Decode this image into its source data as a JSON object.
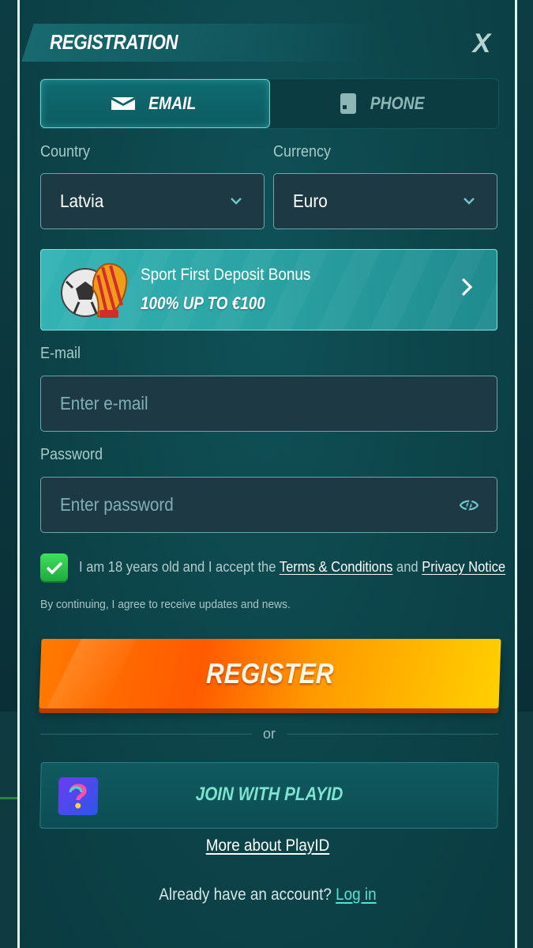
{
  "header": {
    "title": "REGISTRATION",
    "close_label": "X"
  },
  "tabs": [
    {
      "label": "EMAIL",
      "icon": "envelope-icon",
      "active": true
    },
    {
      "label": "PHONE",
      "icon": "phone-icon",
      "active": false
    }
  ],
  "country": {
    "label": "Country",
    "value": "Latvia"
  },
  "currency": {
    "label": "Currency",
    "value": "Euro"
  },
  "bonus": {
    "title": "Sport First Deposit Bonus",
    "subtitle": "100% UP TO €100",
    "icon": "soccer-ball-glove-icon"
  },
  "email": {
    "label": "E-mail",
    "placeholder": "Enter e-mail"
  },
  "password": {
    "label": "Password",
    "placeholder": "Enter password"
  },
  "consent": {
    "checked": true,
    "prefix": "I am 18 years old and I accept the",
    "terms_label": "Terms & Conditions",
    "and": "and",
    "privacy_label": "Privacy Notice"
  },
  "note": "By continuing, I agree to receive updates and news.",
  "register_label": "REGISTER",
  "or_label": "or",
  "playid": {
    "label": "JOIN WITH PLAYID",
    "more_label": "More about PlayID"
  },
  "login": {
    "prompt": "Already have an account?",
    "link_label": "Log in"
  },
  "colors": {
    "accent": "#58e0d3",
    "register_orange": "#ff6a00",
    "checkbox_green": "#2ec24d",
    "panel": "#0c4449"
  }
}
